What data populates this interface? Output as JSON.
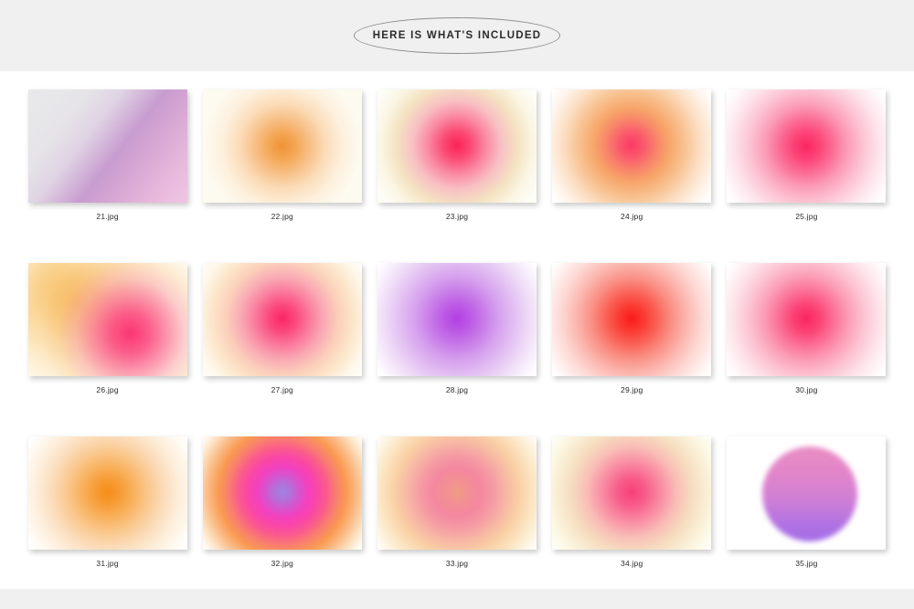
{
  "header": {
    "title": "HERE IS WHAT'S INCLUDED",
    "band_color": "#f0f0f0",
    "ellipse_stroke": "#8d8d8d"
  },
  "footer": {
    "band_color": "#f0f0f0"
  },
  "gallery": {
    "columns": 5,
    "rows": 3,
    "items": [
      {
        "label": "21.jpg",
        "style": "diagonal-gradient",
        "background": "linear-gradient(128deg, #e8e8ea 0%, #e6e4e8 24%, #e0d4e4 38%, #c89cd0 56%, #d9a8d4 70%, #e9b9dd 86%, #efc5e2 100%)",
        "colors": [
          "#e8e8ea",
          "#c89cd0",
          "#efc5e2"
        ]
      },
      {
        "label": "22.jpg",
        "style": "radial-blob",
        "background": "#fdfaf0",
        "colors": [
          "#f29b3c",
          "#f7bd7a",
          "#fdf7e8"
        ],
        "blob": "radial-gradient(circle at 50% 50%, #f09138 0%, #f4a653 13%, #f7bf86 28%, #fbdcb8 44%, #fdf0dd 62%, #fdfaf0 80%)"
      },
      {
        "label": "23.jpg",
        "style": "radial-blob",
        "background": "#fdfdf7",
        "colors": [
          "#fa2e62",
          "#f9889f",
          "#f6eec4"
        ],
        "blob": "radial-gradient(circle at 50% 49%, #fb2257 0%, #fb4a74 14%, #fa8ba4 30%, #f8c0c3 45%, #f4e3c2 62%, #fbf6e4 78%, #fdfdf7 92%)"
      },
      {
        "label": "24.jpg",
        "style": "radial-blob",
        "background": "#ffffff",
        "colors": [
          "#fb3f68",
          "#f8a060",
          "#fbd8ab"
        ],
        "blob": "radial-gradient(circle at 50% 49%, #fb3a63 0%, #fa5a6c 13%, #f8856a 26%, #f7a569 38%, #f8c291 54%, #fbdfc4 70%, #fef5ec 86%, #ffffff 96%)"
      },
      {
        "label": "25.jpg",
        "style": "radial-blob",
        "background": "#ffffff",
        "colors": [
          "#fc2e66",
          "#fb7a9e",
          "#fdd2de"
        ],
        "blob": "radial-gradient(circle at 50% 50%, #fc2663 0%, #fc4477 14%, #fb6e96 28%, #fb9cb7 42%, #fcc3d3 58%, #fde3eb 74%, #fff7fa 88%, #ffffff 96%)"
      },
      {
        "label": "26.jpg",
        "style": "two-blobs",
        "background": "#fffdf8",
        "colors": [
          "#f5a62e",
          "#fb3c74",
          "#fbe0b5"
        ],
        "blob": "radial-gradient(circle at 64% 62%, rgba(251,44,110,0.95) 0%, rgba(251,78,131,0.9) 16%, rgba(250,125,156,0.8) 30%, rgba(250,175,178,0.6) 44%, rgba(250,213,168,0.45) 58%, rgba(253,240,214,0.25) 72%, rgba(255,253,248,0) 88%), radial-gradient(circle at 29% 33%, rgba(244,162,42,0.95) 0%, rgba(246,179,72,0.9) 16%, rgba(248,200,116,0.75) 32%, rgba(251,222,168,0.55) 50%, rgba(253,242,215,0.3) 68%, rgba(255,253,248,0) 86%)"
      },
      {
        "label": "27.jpg",
        "style": "radial-blob",
        "background": "#fffcf6",
        "colors": [
          "#fb2f6a",
          "#fa89a8",
          "#fbe2c8"
        ],
        "blob": "radial-gradient(circle at 50% 49%, #fb2566 0%, #fb4a7d 14%, #fa7b9c 28%, #f9a9b4 42%, #fbcfba 57%, #fce6ca 72%, #fef7ea 87%, #fffcf6 96%)"
      },
      {
        "label": "28.jpg",
        "style": "radial-blob",
        "background": "#ffffff",
        "colors": [
          "#b44fe0",
          "#cd8ce8",
          "#e8cdf3"
        ],
        "blob": "radial-gradient(circle at 50% 49%, #b240e2 0%, #bd5ae5 14%, #c87ce8 28%, #d59fed 42%, #e2bef2 58%, #efdcf7 74%, #faf3fd 88%, #ffffff 96%)"
      },
      {
        "label": "29.jpg",
        "style": "radial-blob",
        "background": "#ffffff",
        "colors": [
          "#fb2020",
          "#fa6a62",
          "#fcc6c0"
        ],
        "blob": "radial-gradient(circle at 50% 49%, #fb1a1a 0%, #fb3b33 13%, #fa6156 26%, #fa8d82 40%, #fbb6ae 56%, #fdd9d4 72%, #fef3f1 88%, #ffffff 96%)"
      },
      {
        "label": "30.jpg",
        "style": "radial-blob",
        "background": "#ffffff",
        "colors": [
          "#fb2c66",
          "#fb7b9e",
          "#fdd4df"
        ],
        "blob": "radial-gradient(circle at 50% 49%, #fb2462 0%, #fb4375 14%, #fb6f95 28%, #fb9db6 43%, #fcc4d2 59%, #fde4ea 75%, #fff7f9 89%, #ffffff 96%)"
      },
      {
        "label": "31.jpg",
        "style": "radial-blob",
        "background": "#ffffff",
        "colors": [
          "#f6941f",
          "#f8b35b",
          "#fce0b3"
        ],
        "blob": "radial-gradient(circle at 50% 49%, #f68c18 0%, #f79c35 13%, #f8b25f 27%, #fac78c 41%, #fbdcba 57%, #fdeedb 73%, #fffaf3 88%, #ffffff 96%)"
      },
      {
        "label": "32.jpg",
        "style": "layered-blob",
        "background": "#fffdf9",
        "colors": [
          "#9a7ee0",
          "#fb41c0",
          "#f9a84f"
        ],
        "blob": "radial-gradient(circle at 50% 49%, #9f84e2 0%, #b56fd8 9%, #d455ce 17%, #f341c0 26%, #fa45a8 35%, #fa5b8c 45%, #f97f6e 55%, #f99a52 65%, #fbbc87 76%, #fddfbf 86%, #fef6ea 94%, #fffdf9 99%)"
      },
      {
        "label": "33.jpg",
        "style": "radial-blob",
        "background": "#fffdf9",
        "colors": [
          "#f09a86",
          "#f3849b",
          "#fbd6a8"
        ],
        "blob": "radial-gradient(circle at 50% 49%, #ef9d84 0%, #f28f93 12%, #f4879e 24%, #f59aa4 37%, #f7b6a4 50%, #f9cfa4 63%, #fbe3bf 76%, #fdf3de 88%, #fffdf9 97%)"
      },
      {
        "label": "34.jpg",
        "style": "radial-blob",
        "background": "#fdfdf6",
        "colors": [
          "#f74a7e",
          "#f9a0ab",
          "#f5e8c6"
        ],
        "blob": "radial-gradient(circle at 50% 49%, #f73f77 0%, #f85e8b 15%, #f98fa5 31%, #f9bdb6 46%, #f6dcbf 61%, #f9eed4 76%, #fdfaea 89%, #fdfdf6 97%)"
      },
      {
        "label": "35.jpg",
        "style": "hard-circle-gradient",
        "background": "#ffffff",
        "colors": [
          "#e486c4",
          "#d382d6",
          "#a86ee6"
        ],
        "blob": "linear-gradient(180deg, #e98dc4 0%, #e285c9 28%, #d07fd6 56%, #b172e3 82%, #a36ce8 100%)"
      }
    ]
  }
}
